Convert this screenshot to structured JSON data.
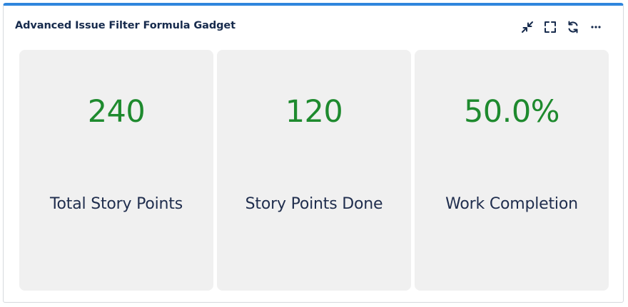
{
  "gadget": {
    "title": "Advanced Issue Filter Formula Gadget",
    "accent_color": "#2f86dd",
    "toolbar": [
      {
        "icon": "minimize-icon"
      },
      {
        "icon": "fullscreen-icon"
      },
      {
        "icon": "refresh-icon"
      },
      {
        "icon": "more-icon"
      }
    ],
    "metric_color": "#1e8a2e",
    "tiles": [
      {
        "value": "240",
        "label": "Total Story Points"
      },
      {
        "value": "120",
        "label": "Story Points Done"
      },
      {
        "value": "50.0%",
        "label": "Work Completion"
      }
    ]
  }
}
